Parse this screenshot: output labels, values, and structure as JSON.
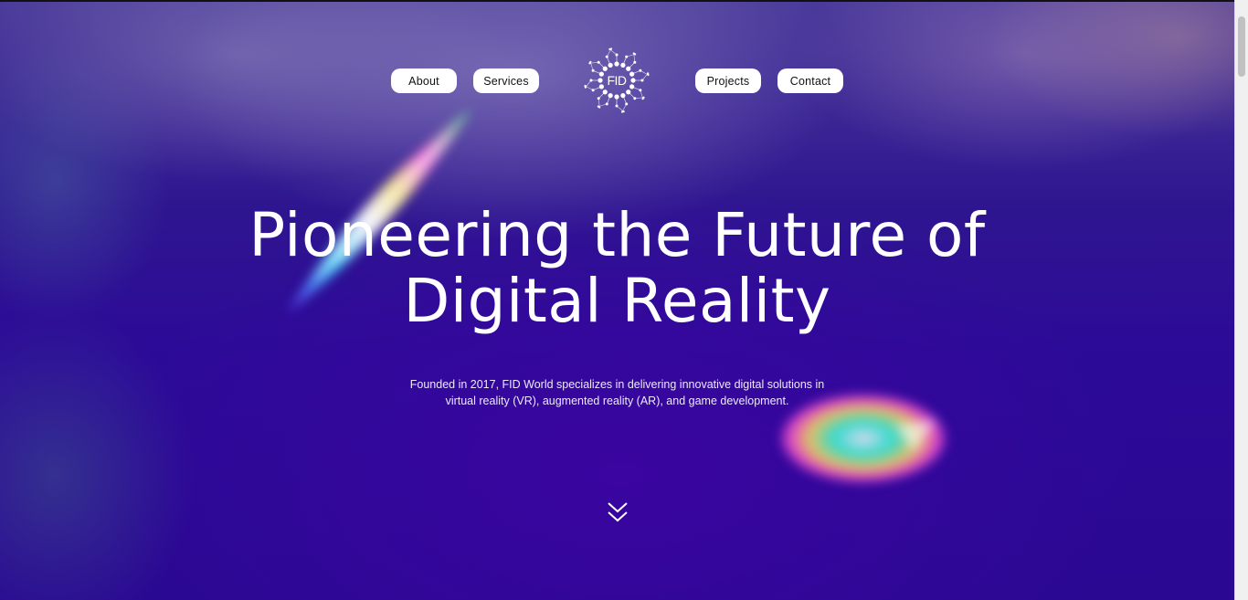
{
  "nav": {
    "left": [
      {
        "label": "About"
      },
      {
        "label": "Services"
      }
    ],
    "right": [
      {
        "label": "Projects"
      },
      {
        "label": "Contact"
      }
    ],
    "logo_text": "FID"
  },
  "hero": {
    "title_line1": "Pioneering the Future of",
    "title_line2": "Digital Reality",
    "description_line1": "Founded in 2017, FID World specializes in delivering innovative digital solutions in",
    "description_line2": "virtual reality (VR), augmented reality (AR), and game development."
  },
  "icons": {
    "scroll": "double-chevron-down-icon",
    "logo": "dotted-circle-logo-icon"
  },
  "colors": {
    "background": "#2c0a98",
    "button_bg": "#ffffff",
    "text": "#ffffff"
  }
}
